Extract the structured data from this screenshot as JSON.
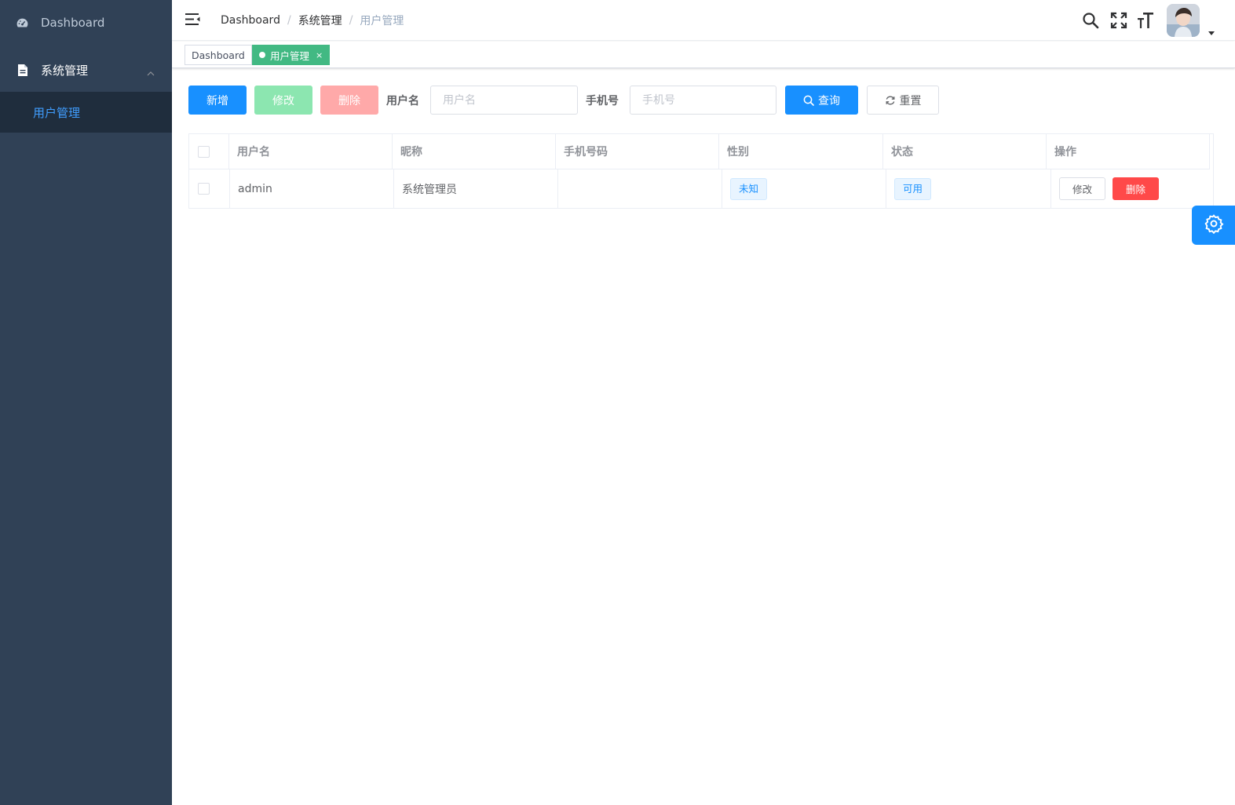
{
  "sidebar": {
    "items": [
      {
        "label": "Dashboard",
        "icon": "dashboard-icon"
      },
      {
        "label": "系统管理",
        "icon": "document-icon",
        "expanded": true,
        "children": [
          {
            "label": "用户管理",
            "active": true
          }
        ]
      }
    ]
  },
  "navbar": {
    "breadcrumb": [
      "Dashboard",
      "系统管理",
      "用户管理"
    ],
    "icons": [
      "search-icon",
      "fullscreen-icon",
      "font-size-icon"
    ]
  },
  "tags": {
    "items": [
      {
        "label": "Dashboard",
        "active": false
      },
      {
        "label": "用户管理",
        "active": true,
        "close": "×"
      }
    ]
  },
  "toolbar": {
    "add_label": "新增",
    "edit_label": "修改",
    "delete_label": "删除",
    "username_label": "用户名",
    "username_placeholder": "用户名",
    "phone_label": "手机号",
    "phone_placeholder": "手机号",
    "query_label": "查询",
    "reset_label": "重置"
  },
  "table": {
    "headers": [
      "用户名",
      "昵称",
      "手机号码",
      "性别",
      "状态",
      "操作"
    ],
    "rows": [
      {
        "username": "admin",
        "nickname": "系统管理员",
        "phone": "",
        "gender": "未知",
        "status": "可用",
        "edit_label": "修改",
        "delete_label": "删除"
      }
    ]
  },
  "colors": {
    "sidebar_bg": "#304156",
    "primary": "#1890ff",
    "success": "#42b983",
    "danger": "#ff4949"
  }
}
